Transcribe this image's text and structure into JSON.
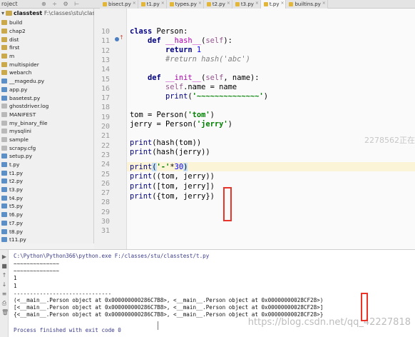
{
  "header": {
    "project_label": "roject",
    "toolbar_icons": "⊕ ÷ ⚙ ⊢",
    "tabs": [
      {
        "label": "bisect.py",
        "active": false
      },
      {
        "label": "t1.py",
        "active": false
      },
      {
        "label": "types.py",
        "active": false
      },
      {
        "label": "t2.py",
        "active": false
      },
      {
        "label": "t3.py",
        "active": false
      },
      {
        "label": "t.py",
        "active": true
      },
      {
        "label": "builtins.py",
        "active": false
      }
    ],
    "tab_close_glyph": "×"
  },
  "sidebar": {
    "root_arrow": "▾",
    "root_name": "classtest",
    "root_path": "F:\\classes\\stu\\classtest",
    "items": [
      {
        "label": "build",
        "type": "folder"
      },
      {
        "label": "chap2",
        "type": "folder"
      },
      {
        "label": "dist",
        "type": "folder"
      },
      {
        "label": "first",
        "type": "folder"
      },
      {
        "label": "m",
        "type": "folder"
      },
      {
        "label": "multispider",
        "type": "folder"
      },
      {
        "label": "webarch",
        "type": "folder"
      },
      {
        "label": "__magedu.py",
        "type": "py"
      },
      {
        "label": "app.py",
        "type": "py"
      },
      {
        "label": "basetest.py",
        "type": "py"
      },
      {
        "label": "ghostdriver.log",
        "type": "file"
      },
      {
        "label": "MANIFEST",
        "type": "file"
      },
      {
        "label": "my_binary_file",
        "type": "file"
      },
      {
        "label": "mysqlini",
        "type": "file"
      },
      {
        "label": "sample",
        "type": "file"
      },
      {
        "label": "scrapy.cfg",
        "type": "file"
      },
      {
        "label": "setup.py",
        "type": "py"
      },
      {
        "label": "t.py",
        "type": "py"
      },
      {
        "label": "t1.py",
        "type": "py"
      },
      {
        "label": "t2.py",
        "type": "py"
      },
      {
        "label": "t3.py",
        "type": "py"
      },
      {
        "label": "t4.py",
        "type": "py"
      },
      {
        "label": "t5.py",
        "type": "py"
      },
      {
        "label": "t6.py",
        "type": "py"
      },
      {
        "label": "t7.py",
        "type": "py"
      },
      {
        "label": "t8.py",
        "type": "py"
      },
      {
        "label": "t11.py",
        "type": "py"
      }
    ]
  },
  "editor": {
    "line_numbers": [
      "10",
      "11",
      "12",
      "13",
      "14",
      "15",
      "16",
      "17",
      "18",
      "19",
      "20",
      "21",
      "22",
      "23",
      "24",
      "25",
      "26",
      "27",
      "28",
      "29",
      "30",
      "31"
    ],
    "current_line": "24",
    "code": {
      "l10": {
        "kw": "class",
        "rest": " Person:"
      },
      "l11": {
        "kw": "def",
        "fn": "__hash__",
        "open": "(",
        "self": "self",
        "close": "):"
      },
      "l12": {
        "kw": "return",
        "num": "1"
      },
      "l13": {
        "comment": "#return hash('abc')"
      },
      "l15": {
        "kw": "def",
        "fn": "__init__",
        "open": "(",
        "self": "self",
        "rest": ", name):"
      },
      "l16": {
        "self": "self",
        "rest": ".name = name"
      },
      "l17": {
        "bi": "print",
        "open": "(",
        "str": "'~~~~~~~~~~~~~~'",
        "close": ")"
      },
      "l19": {
        "rest": "tom = Person(",
        "str": "'tom'",
        "close": ")"
      },
      "l20": {
        "rest": "jerry = Person(",
        "str": "'jerry'",
        "close": ")"
      },
      "l22": {
        "bi": "print",
        "rest": "(hash(tom))"
      },
      "l23": {
        "bi": "print",
        "rest": "(hash(jerry))"
      },
      "l24": {
        "bi": "print",
        "open": "(",
        "str": "'-'",
        "op": "*",
        "num": "30",
        "close": ")"
      },
      "l25": {
        "bi": "print",
        "rest": "((tom, jerry))"
      },
      "l26": {
        "bi": "print",
        "rest": "([tom, jerry])"
      },
      "l27": {
        "bi": "print",
        "rest": "({tom, jerry})"
      }
    },
    "watermark": "2278562正在"
  },
  "console": {
    "tool_icons": [
      "▶",
      "■",
      "↑",
      "↓",
      "≡",
      "⎙",
      "🗑"
    ],
    "lines": [
      {
        "text": "C:\\Python\\Python366\\python.exe F:/classes/stu/classtest/t.py",
        "kind": "cmd"
      },
      {
        "text": "~~~~~~~~~~~~~~",
        "kind": "out"
      },
      {
        "text": "~~~~~~~~~~~~~~",
        "kind": "out"
      },
      {
        "text": "1",
        "kind": "out"
      },
      {
        "text": "1",
        "kind": "out"
      },
      {
        "text": "------------------------------",
        "kind": "out"
      },
      {
        "text": "(<__main__.Person object at 0x000000000286C7B8>, <__main__.Person object at 0x00000000028CF28>)",
        "kind": "out"
      },
      {
        "text": "[<__main__.Person object at 0x000000000286C7B8>, <__main__.Person object at 0x00000000028CF28>]",
        "kind": "out"
      },
      {
        "text": "{<__main__.Person object at 0x000000000286C7B8>, <__main__.Person object at 0x00000000028CF28>}",
        "kind": "out"
      },
      {
        "text": "",
        "kind": "out"
      },
      {
        "text": "Process finished with exit code 0",
        "kind": "fin"
      }
    ],
    "watermark": "https://blog.csdn.net/qq_42227818"
  },
  "colors": {
    "annotation_red": "#e8342a",
    "keyword": "#000080",
    "function_name": "#b200b2",
    "string": "#008000",
    "number": "#0000ff",
    "comment": "#808080",
    "self": "#94558d"
  }
}
